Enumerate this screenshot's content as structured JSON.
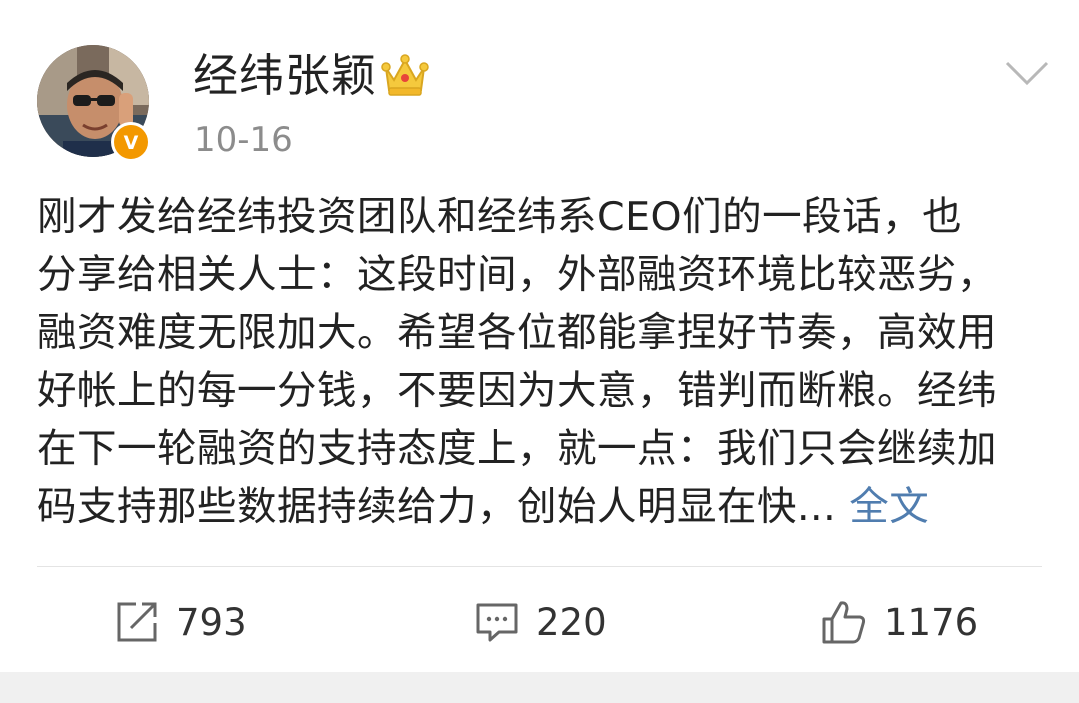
{
  "post": {
    "author": "经纬张颖",
    "timestamp": "10-16",
    "content_lines": [
      "刚才发给经纬投资团队和经纬系CEO们的一段话，也",
      "分享给相关人士：这段时间，外部融资环境比较恶劣，",
      "融资难度无限加大。希望各位都能拿捏好节奏，高效用",
      "好帐上的每一分钱，不要因为大意，错判而断粮。经纬",
      "在下一轮融资的支持态度上，就一点：我们只会继续加",
      "码支持那些数据持续给力，创始人明显在快... "
    ],
    "more_label": "全文",
    "verified_mark": "V",
    "repost_count": "793",
    "comment_count": "220",
    "like_count": "1176"
  },
  "icons": {
    "avatar": "avatar-photo",
    "verified": "verified-badge-icon",
    "crown": "crown-icon",
    "menu": "chevron-down-icon",
    "repost": "repost-icon",
    "comment": "comment-icon",
    "like": "thumbs-up-icon"
  },
  "colors": {
    "link": "#507daf",
    "verified_badge": "#f39800",
    "crown": "#f5c93d",
    "meta_text": "#8c8c8c"
  }
}
